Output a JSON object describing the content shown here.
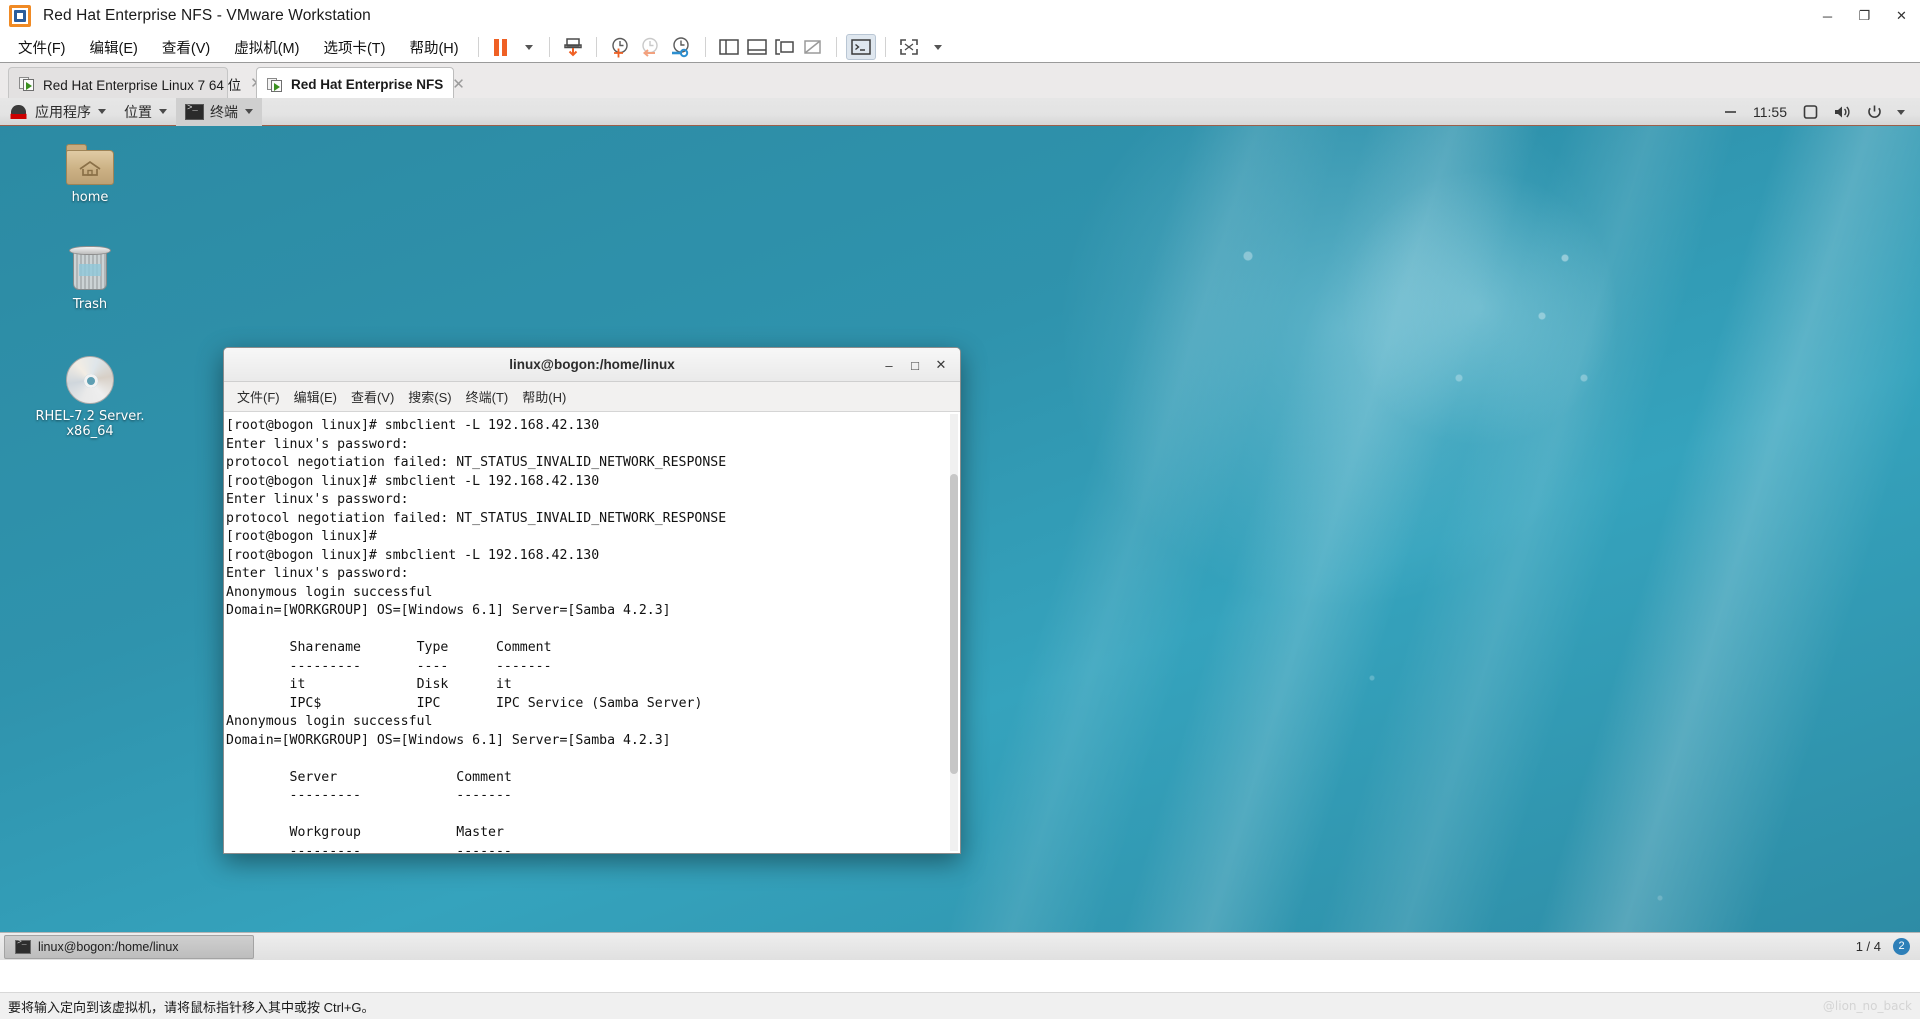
{
  "window": {
    "title": "Red Hat Enterprise NFS - VMware Workstation",
    "minimize": "─",
    "maximize": "❐",
    "close": "✕"
  },
  "menubar": {
    "items": [
      {
        "label": "文件(F)",
        "name": "menu-file"
      },
      {
        "label": "编辑(E)",
        "name": "menu-edit"
      },
      {
        "label": "查看(V)",
        "name": "menu-view"
      },
      {
        "label": "虚拟机(M)",
        "name": "menu-vm"
      },
      {
        "label": "选项卡(T)",
        "name": "menu-tabs"
      },
      {
        "label": "帮助(H)",
        "name": "menu-help"
      }
    ]
  },
  "toolbar": {
    "icons": [
      {
        "name": "suspend-icon",
        "label": "Suspend"
      },
      {
        "name": "dropdown-caret-icon",
        "label": ""
      },
      {
        "name": "power-on-guest-icon",
        "label": "Power"
      },
      {
        "name": "snapshot-take-icon",
        "label": "Take snapshot"
      },
      {
        "name": "snapshot-revert-icon",
        "label": "Revert snapshot"
      },
      {
        "name": "snapshot-manager-icon",
        "label": "Snapshot manager"
      },
      {
        "name": "show-left-sidebar-icon",
        "label": "Library"
      },
      {
        "name": "show-bottom-panel-icon",
        "label": "Thumbnail bar"
      },
      {
        "name": "show-console-view-icon",
        "label": "Console view"
      },
      {
        "name": "hide-panel-icon",
        "label": "Hide"
      },
      {
        "name": "unity-mode-icon",
        "label": "Unity"
      },
      {
        "name": "fullscreen-icon",
        "label": "Full screen"
      }
    ]
  },
  "tabs": [
    {
      "label": "Red Hat Enterprise Linux 7 64 位",
      "active": false,
      "close": "✕"
    },
    {
      "label": "Red Hat Enterprise NFS",
      "active": true,
      "close": "✕"
    }
  ],
  "gnome_panel": {
    "applications": "应用程序",
    "places": "位置",
    "terminal": "终端",
    "clock": "11:55",
    "icons": [
      "minimize-indicator-icon",
      "display-icon",
      "volume-icon",
      "power-icon",
      "chevron-down-icon"
    ]
  },
  "desktop_icons": [
    {
      "name": "desktop-icon-home",
      "label": "home",
      "glyph": "folder"
    },
    {
      "name": "desktop-icon-trash",
      "label": "Trash",
      "glyph": "trash"
    },
    {
      "name": "desktop-icon-rhel-iso",
      "label": "RHEL-7.2 Server.\nx86_64",
      "glyph": "cd"
    }
  ],
  "terminal": {
    "title": "linux@bogon:/home/linux",
    "title_buttons": {
      "minimize": "–",
      "maximize": "□",
      "close": "✕"
    },
    "menu": [
      "文件(F)",
      "编辑(E)",
      "查看(V)",
      "搜索(S)",
      "终端(T)",
      "帮助(H)"
    ],
    "content": "[root@bogon linux]# smbclient -L 192.168.42.130\nEnter linux's password:\nprotocol negotiation failed: NT_STATUS_INVALID_NETWORK_RESPONSE\n[root@bogon linux]# smbclient -L 192.168.42.130\nEnter linux's password:\nprotocol negotiation failed: NT_STATUS_INVALID_NETWORK_RESPONSE\n[root@bogon linux]#\n[root@bogon linux]# smbclient -L 192.168.42.130\nEnter linux's password:\nAnonymous login successful\nDomain=[WORKGROUP] OS=[Windows 6.1] Server=[Samba 4.2.3]\n\n\tSharename       Type      Comment\n\t---------       ----      -------\n\tit              Disk      it\n\tIPC$            IPC       IPC Service (Samba Server)\nAnonymous login successful\nDomain=[WORKGROUP] OS=[Windows 6.1] Server=[Samba 4.2.3]\n\n\tServer               Comment\n\t---------            -------\n\n\tWorkgroup            Master\n\t---------            -------"
  },
  "gnome_bottom": {
    "window_button": "linux@bogon:/home/linux",
    "workspace": "1 / 4",
    "badge": "2"
  },
  "vm_status": {
    "hint": "要将输入定向到该虚拟机，请将鼠标指针移入其中或按 Ctrl+G。",
    "watermark": "@lion_no_back"
  },
  "colors": {
    "vmware_orange": "#ef6024",
    "vmware_blue": "#2b5c9b",
    "desktop_teal": "#2f93ad",
    "accent_blue": "#2d7fb8"
  }
}
